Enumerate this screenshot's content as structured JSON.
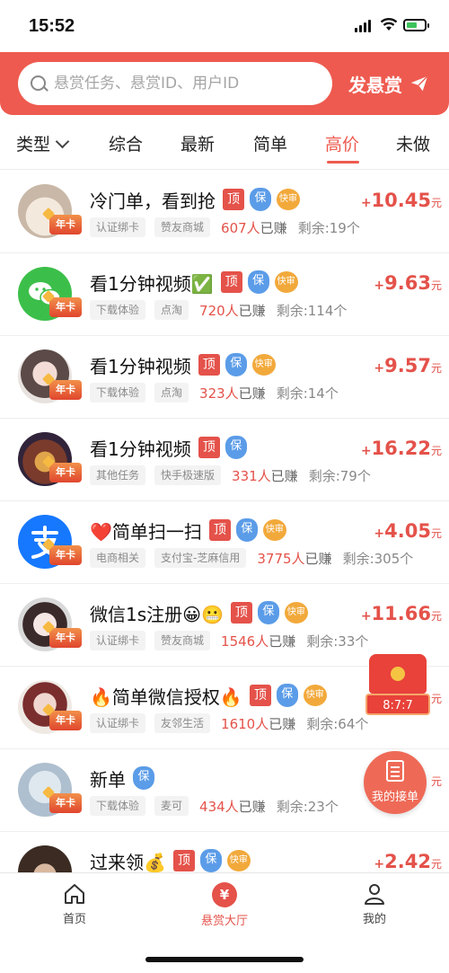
{
  "status_bar": {
    "time": "15:52"
  },
  "header": {
    "search_placeholder": "悬赏任务、悬赏ID、用户ID",
    "post_button": "发悬赏"
  },
  "tabs": [
    {
      "label": "类型"
    },
    {
      "label": "综合"
    },
    {
      "label": "最新"
    },
    {
      "label": "简单"
    },
    {
      "label": "高价"
    },
    {
      "label": "未做"
    }
  ],
  "colors": {
    "accent": "#ee5a4f",
    "price": "#e4524a",
    "bao_blue": "#5b9ce8",
    "kuai_gold": "#f2a93b"
  },
  "rows": [
    {
      "title": "冷门单，看到抢",
      "badge": "年卡",
      "tags": {
        "ding": "顶",
        "bao": "保",
        "kuai": "快审"
      },
      "pill1": "认证绑卡",
      "pill2": "赞友商城",
      "earned_count": "607人",
      "earned_suffix": "已赚",
      "remaining": "剩余:19个",
      "price_sign": "+",
      "price": "10.45",
      "unit": "元"
    },
    {
      "title": "看1分钟视频✅",
      "badge": "年卡",
      "tags": {
        "ding": "顶",
        "bao": "保",
        "kuai": "快审"
      },
      "pill1": "下载体验",
      "pill2": "点淘",
      "earned_count": "720人",
      "earned_suffix": "已赚",
      "remaining": "剩余:114个",
      "price_sign": "+",
      "price": "9.63",
      "unit": "元"
    },
    {
      "title": "看1分钟视频",
      "badge": "年卡",
      "tags": {
        "ding": "顶",
        "bao": "保",
        "kuai": "快审"
      },
      "pill1": "下载体验",
      "pill2": "点淘",
      "earned_count": "323人",
      "earned_suffix": "已赚",
      "remaining": "剩余:14个",
      "price_sign": "+",
      "price": "9.57",
      "unit": "元"
    },
    {
      "title": "看1分钟视频",
      "badge": "年卡",
      "tags": {
        "ding": "顶",
        "bao": "保"
      },
      "pill1": "其他任务",
      "pill2": "快手极速版",
      "earned_count": "331人",
      "earned_suffix": "已赚",
      "remaining": "剩余:79个",
      "price_sign": "+",
      "price": "16.22",
      "unit": "元"
    },
    {
      "title": "❤️简单扫一扫",
      "badge": "年卡",
      "tags": {
        "ding": "顶",
        "bao": "保",
        "kuai": "快审"
      },
      "pill1": "电商相关",
      "pill2": "支付宝-芝麻信用",
      "earned_count": "3775人",
      "earned_suffix": "已赚",
      "remaining": "剩余:305个",
      "price_sign": "+",
      "price": "4.05",
      "unit": "元"
    },
    {
      "title": "微信1s注册😀😬",
      "badge": "年卡",
      "tags": {
        "ding": "顶",
        "bao": "保",
        "kuai": "快审"
      },
      "pill1": "认证绑卡",
      "pill2": "赞友商城",
      "earned_count": "1546人",
      "earned_suffix": "已赚",
      "remaining": "剩余:33个",
      "price_sign": "+",
      "price": "11.66",
      "unit": "元"
    },
    {
      "title": "🔥简单微信授权🔥",
      "badge": "年卡",
      "tags": {
        "ding": "顶",
        "bao": "保",
        "kuai": "快审"
      },
      "pill1": "认证绑卡",
      "pill2": "友邻生活",
      "earned_count": "1610人",
      "earned_suffix": "已赚",
      "remaining": "剩余:64个",
      "price_sign": "",
      "price": "",
      "unit": "元"
    },
    {
      "title": "新单",
      "badge": "年卡",
      "tags": {
        "bao": "保"
      },
      "pill1": "下载体验",
      "pill2": "麦可",
      "earned_count": "434人",
      "earned_suffix": "已赚",
      "remaining": "剩余:23个",
      "price_sign": "",
      "price": "",
      "unit": "元"
    },
    {
      "title": "过来领💰",
      "badge": "",
      "tags": {
        "ding": "顶",
        "bao": "保",
        "kuai": "快审"
      },
      "pill1": "",
      "pill2": "",
      "earned_count": "",
      "earned_suffix": "",
      "remaining": "",
      "price_sign": "+",
      "price": "2.42",
      "unit": "元"
    }
  ],
  "floating": {
    "red_packet_timer": "8:7:7",
    "my_orders_label": "我的接单"
  },
  "tabbar": [
    {
      "label": "首页",
      "icon": "home-icon"
    },
    {
      "label": "悬赏大厅",
      "icon": "yuan-icon",
      "glyph": "¥"
    },
    {
      "label": "我的",
      "icon": "person-icon"
    }
  ]
}
